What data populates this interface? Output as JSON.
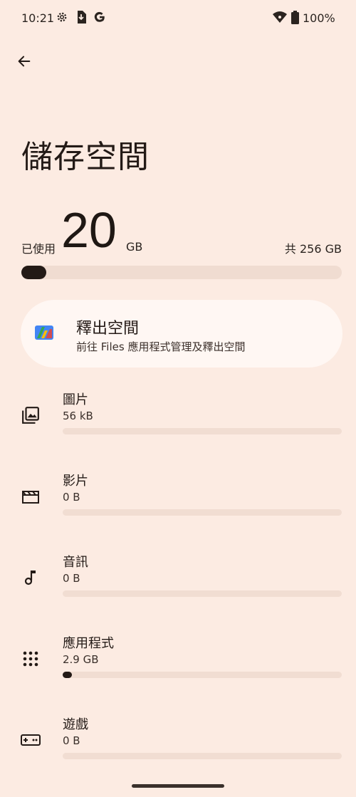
{
  "status_bar": {
    "time": "10:21",
    "battery_pct": "100%",
    "icons": [
      "settings-icon",
      "download-icon",
      "google-icon",
      "wifi-icon",
      "battery-icon"
    ]
  },
  "header": {
    "title": "儲存空間"
  },
  "summary": {
    "used_label": "已使用",
    "used_value": "20",
    "used_unit": "GB",
    "total_label": "共 256 GB",
    "used_fraction": 0.078
  },
  "free_up": {
    "title": "釋出空間",
    "subtitle": "前往 Files 應用程式管理及釋出空間"
  },
  "categories": [
    {
      "name": "圖片",
      "size": "56 kB",
      "fraction": 0.0,
      "icon": "photo-icon"
    },
    {
      "name": "影片",
      "size": "0 B",
      "fraction": 0.0,
      "icon": "video-icon"
    },
    {
      "name": "音訊",
      "size": "0 B",
      "fraction": 0.0,
      "icon": "music-note-icon"
    },
    {
      "name": "應用程式",
      "size": "2.9 GB",
      "fraction": 0.011,
      "icon": "apps-grid-icon"
    },
    {
      "name": "遊戲",
      "size": "0 B",
      "fraction": 0.0,
      "icon": "gamepad-icon"
    }
  ],
  "colors": {
    "background": "#fcebe2",
    "card": "#fff7f3",
    "track": "#f0dcd1",
    "fill": "#231a16"
  }
}
